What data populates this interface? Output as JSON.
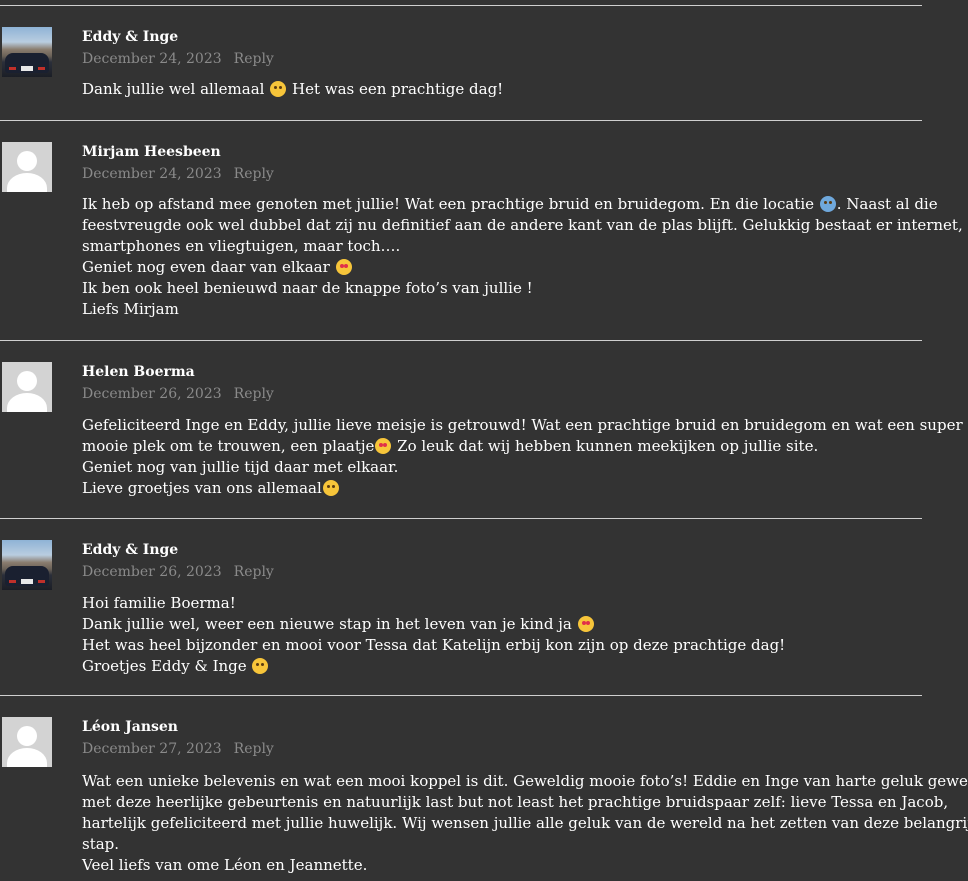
{
  "comments": [
    {
      "author": "Eddy & Inge",
      "date": "December 24, 2023",
      "reply": "Reply",
      "avatar": "car-photo",
      "lines": [
        {
          "a": "Dank jullie wel allemaal ",
          "emoji": "smiling-face-emoji",
          "b": " Het was een prachtige dag!"
        }
      ]
    },
    {
      "author": "Mirjam Heesbeen",
      "date": "December 24, 2023",
      "reply": "Reply",
      "avatar": "generic",
      "lines": [
        {
          "a": "Ik heb op afstand mee genoten met jullie! Wat een prachtige bruid en bruidegom. En die locatie ",
          "emoji": "screaming-face-emoji",
          "b": ". Naast al die"
        },
        {
          "a": "feestvreugde ook wel dubbel dat zij nu definitief aan de andere kant van de plas blijft. Gelukkig bestaat er internet,"
        },
        {
          "a": "smartphones en vliegtuigen, maar toch…."
        },
        {
          "a": "Geniet nog even daar van elkaar ",
          "emoji": "heart-eyes-emoji"
        },
        {
          "a": "Ik ben ook heel benieuwd naar de knappe foto’s van jullie !"
        },
        {
          "a": "Liefs Mirjam"
        }
      ]
    },
    {
      "author": "Helen Boerma",
      "date": "December 26, 2023",
      "reply": "Reply",
      "avatar": "generic",
      "lines": [
        {
          "a": "Gefeliciteerd Inge en Eddy, jullie lieve meisje is getrouwd! Wat een prachtige bruid en bruidegom en wat een super"
        },
        {
          "a": "mooie plek om te trouwen, een plaatje",
          "emoji": "heart-eyes-emoji",
          "b": " Zo leuk dat wij hebben kunnen meekijken op jullie site."
        },
        {
          "a": "Geniet nog van jullie tijd daar met elkaar."
        },
        {
          "a": "Lieve groetjes van ons allemaal",
          "emoji": "kissing-face-emoji"
        }
      ]
    },
    {
      "author": "Eddy & Inge",
      "date": "December 26, 2023",
      "reply": "Reply",
      "avatar": "car-photo",
      "lines": [
        {
          "a": "Hoi familie Boerma!"
        },
        {
          "a": "Dank jullie wel, weer een nieuwe stap in het leven van je kind ja ",
          "emoji": "smiling-hearts-emoji"
        },
        {
          "a": "Het was heel bijzonder en mooi voor Tessa dat Katelijn erbij kon zijn op deze prachtige dag!"
        },
        {
          "a": "Groetjes Eddy & Inge ",
          "emoji": "hugging-face-emoji"
        }
      ]
    },
    {
      "author": "Léon Jansen",
      "date": "December 27, 2023",
      "reply": "Reply",
      "avatar": "generic",
      "lines": [
        {
          "a": "Wat een unieke belevenis en wat een mooi koppel is dit. Geweldig mooie foto’s! Eddie en Inge van harte geluk gewenst"
        },
        {
          "a": "met deze heerlijke gebeurtenis en natuurlijk last but not least het prachtige bruidspaar zelf: lieve Tessa en Jacob,"
        },
        {
          "a": "hartelijk gefeliciteerd met jullie huwelijk. Wij wensen jullie alle geluk van de wereld na het zetten van deze belangrijke"
        },
        {
          "a": "stap."
        },
        {
          "a": "Veel liefs van ome Léon en Jeannette."
        }
      ]
    }
  ]
}
